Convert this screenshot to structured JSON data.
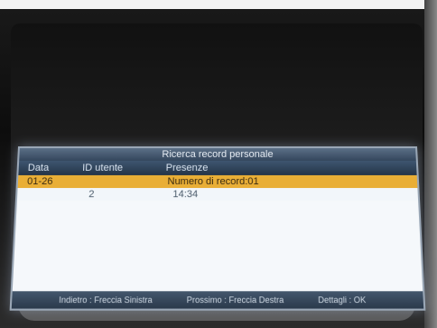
{
  "screen": {
    "title": "Ricerca record personale",
    "columns": {
      "date": "Data",
      "user_id": "ID utente",
      "attendance": "Presenze"
    },
    "rows": [
      {
        "date": "01-26",
        "user_id": "",
        "attendance": "Numero di record:01",
        "selected": true
      },
      {
        "date": "",
        "user_id": "2",
        "attendance": "14:34",
        "selected": false
      }
    ],
    "footer": {
      "back": "Indietro : Freccia Sinistra",
      "next": "Prossimo : Freccia Destra",
      "details": "Dettagli : OK"
    }
  }
}
